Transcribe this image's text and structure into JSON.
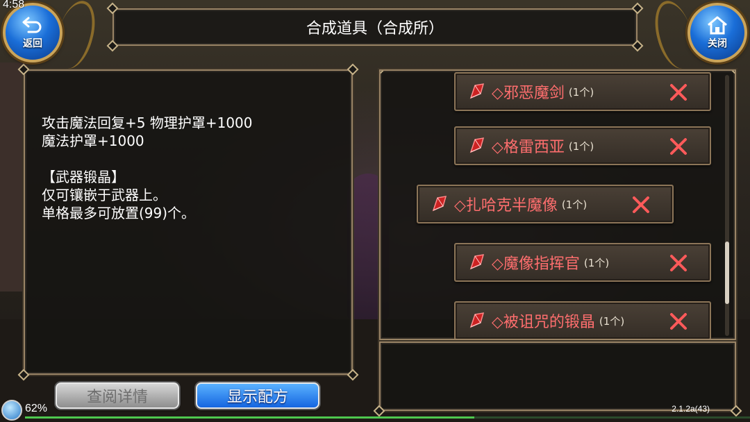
{
  "status": {
    "time": "4:58"
  },
  "nav": {
    "back_label": "返回",
    "close_label": "关闭"
  },
  "title": "合成道具（合成所）",
  "description": {
    "text": "攻击魔法回复+5 物理护罩+1000\n魔法护罩+1000\n\n【武器锻晶】\n仅可镶嵌于武器上。\n单格最多可放置(99)个。"
  },
  "items": [
    {
      "name": "◇邪恶魔剑",
      "qty": "(1个)"
    },
    {
      "name": "◇格雷西亚",
      "qty": "(1个)"
    },
    {
      "name": "◇扎哈克半魔像",
      "qty": "(1个)",
      "selected": true
    },
    {
      "name": "◇魔像指挥官",
      "qty": "(1个)"
    },
    {
      "name": "◇被诅咒的锻晶",
      "qty": "(1个)"
    }
  ],
  "buttons": {
    "detail_label": "查阅详情",
    "recipe_label": "显示配方"
  },
  "footer": {
    "battery": "62%",
    "battery_level": 0.62,
    "version": "2.1.2a(43)"
  },
  "colors": {
    "item_name": "#ff6e6e",
    "panel_border": "#9a8466",
    "recipe_button": "#1565e0",
    "remove_icon": "#ff5a5a"
  }
}
